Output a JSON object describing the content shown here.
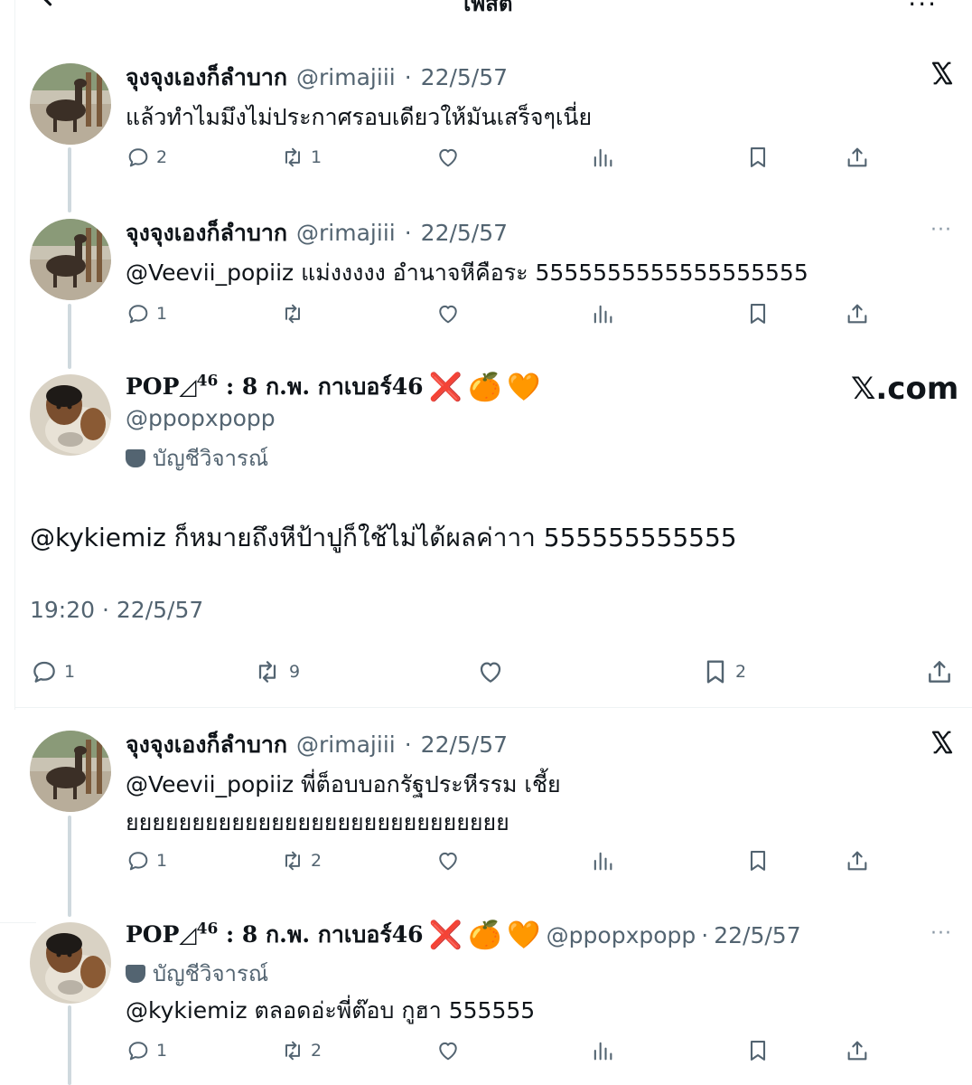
{
  "header": {
    "title": "โพสต์",
    "more": "..."
  },
  "posts": [
    {
      "name": "จุงจุงเองก็ลำบาก",
      "handle": "@rimajiii",
      "sep": "·",
      "date": "22/5/57",
      "text": "แล้วทำไมมึงไม่ประกาศรอบเดียวให้มันเสร็จๆเนี่ย",
      "replies": "2",
      "reposts": "1"
    },
    {
      "name": "จุงจุงเองก็ลำบาก",
      "handle": "@rimajiii",
      "sep": "·",
      "date": "22/5/57",
      "text": "@Veevii_popiiz แม่งงงงง อำนาจหีคือระ 5555555555555555555",
      "replies": "1",
      "more": "···"
    },
    {
      "name_prefix": "POP",
      "name_sup": "46",
      "name_rest": ": 8 ก.พ. กาเบอร์46",
      "emoji_x": "❌",
      "emoji_orange": "🍊",
      "emoji_heart": "🧡",
      "handle": "@ppopxpopp",
      "badge": "บัญชีวิจารณ์",
      "xcom": "𝕏.com",
      "text": "@kykiemiz ก็หมายถึงหีป้าปูก็ใช้ไม่ได้ผลค่าาา 555555555555",
      "timestamp": "19:20 · 22/5/57",
      "replies": "1",
      "reposts": "9",
      "bookmarks": "2"
    },
    {
      "name": "จุงจุงเองก็ลำบาก",
      "handle": "@rimajiii",
      "sep": "·",
      "date": "22/5/57",
      "text_line1": "@Veevii_popiiz พี่ต็อบบอกรัฐประหีรรม เชี้ย",
      "text_line2": "ยยยยยยยยยยยยยยยยยยยยยยยยยยยยย",
      "replies": "1",
      "reposts": "2"
    },
    {
      "name_prefix": "POP",
      "name_sup": "46",
      "name_rest": ": 8 ก.พ. กาเบอร์46",
      "emoji_x": "❌",
      "emoji_orange": "🍊",
      "emoji_heart": "🧡",
      "handle": "@ppopxpopp",
      "sep": "·",
      "date": "22/5/57",
      "badge": "บัญชีวิจารณ์",
      "text": "@kykiemiz ตลอดอ่ะพี่ต๊อบ กูฮา 555555",
      "replies": "1",
      "reposts": "2",
      "more": "···"
    }
  ],
  "icons": [
    "arrow-left-icon",
    "x-logo-icon",
    "reply-icon",
    "repost-icon",
    "like-icon",
    "views-icon",
    "bookmark-icon",
    "share-icon",
    "more-icon",
    "mask-icon"
  ]
}
